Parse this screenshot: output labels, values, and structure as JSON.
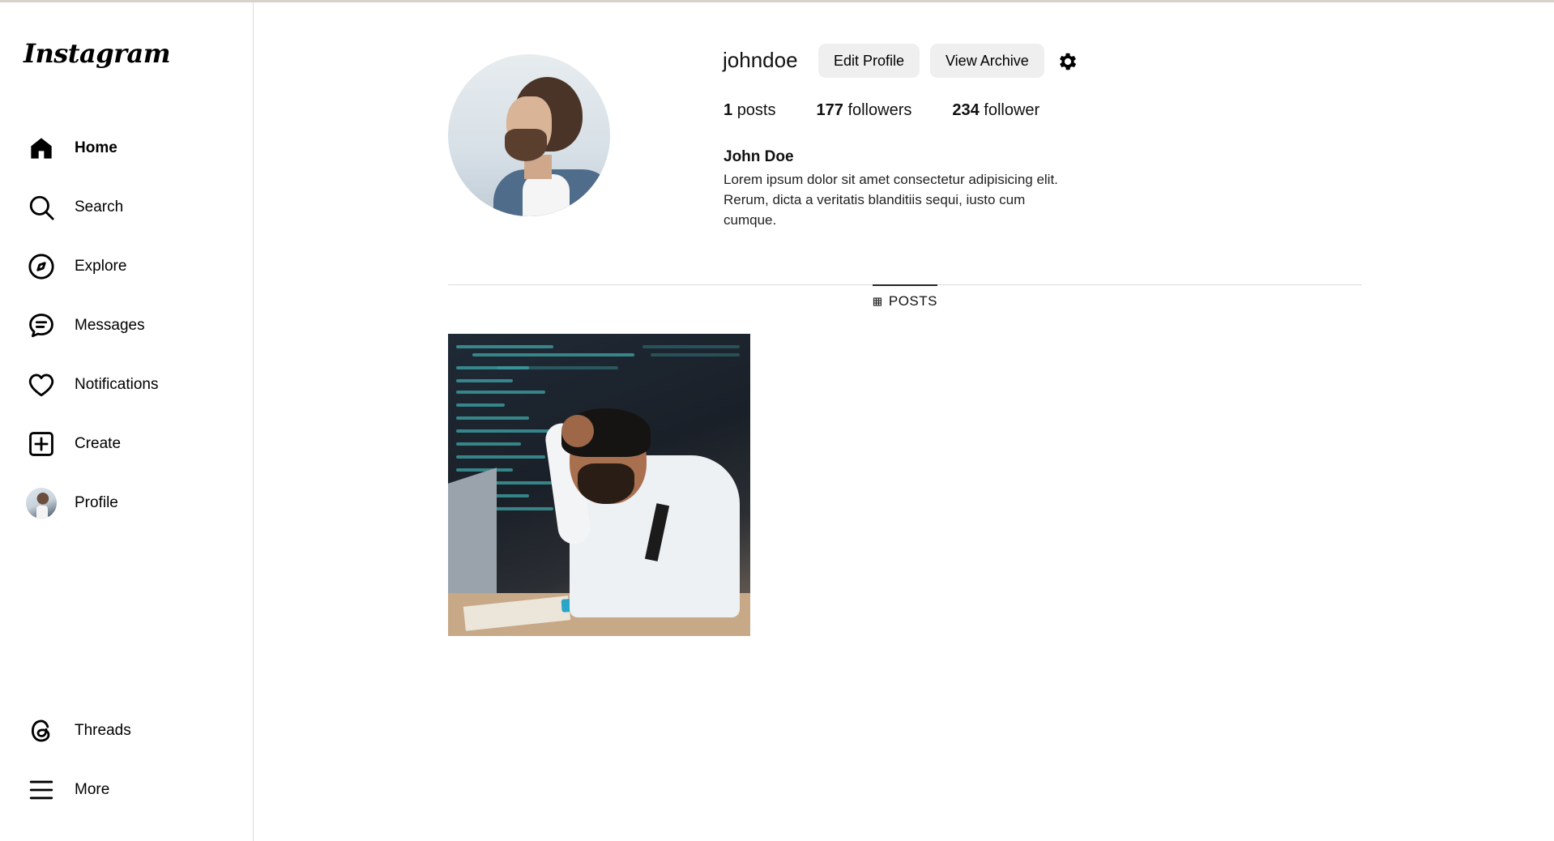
{
  "app": {
    "logo_text": "Instagram"
  },
  "sidebar": {
    "items": [
      {
        "id": "home",
        "label": "Home",
        "icon": "home-icon",
        "active": true
      },
      {
        "id": "search",
        "label": "Search",
        "icon": "search-icon",
        "active": false
      },
      {
        "id": "explore",
        "label": "Explore",
        "icon": "compass-icon",
        "active": false
      },
      {
        "id": "messages",
        "label": "Messages",
        "icon": "message-icon",
        "active": false
      },
      {
        "id": "notifications",
        "label": "Notifications",
        "icon": "heart-icon",
        "active": false
      },
      {
        "id": "create",
        "label": "Create",
        "icon": "plus-square-icon",
        "active": false
      },
      {
        "id": "profile",
        "label": "Profile",
        "icon": "avatar",
        "active": false
      }
    ],
    "bottom_items": [
      {
        "id": "threads",
        "label": "Threads",
        "icon": "threads-icon"
      },
      {
        "id": "more",
        "label": "More",
        "icon": "menu-icon"
      }
    ]
  },
  "profile": {
    "username": "johndoe",
    "edit_label": "Edit Profile",
    "archive_label": "View Archive",
    "settings_icon": "gear-icon",
    "stats": {
      "posts_count": "1",
      "posts_label": "posts",
      "followers_count": "177",
      "followers_label": "followers",
      "following_count": "234",
      "following_label": "follower"
    },
    "full_name": "John Doe",
    "bio": "Lorem ipsum dolor sit amet consectetur adipisicing elit. Rerum, dicta a veritatis blanditiis sequi, iusto cum cumque."
  },
  "tabs": {
    "posts_label": "POSTS",
    "posts_icon": "grid-icon"
  },
  "colors": {
    "button_bg": "#efefef",
    "divider": "#dbdbdb",
    "text": "#000000"
  }
}
